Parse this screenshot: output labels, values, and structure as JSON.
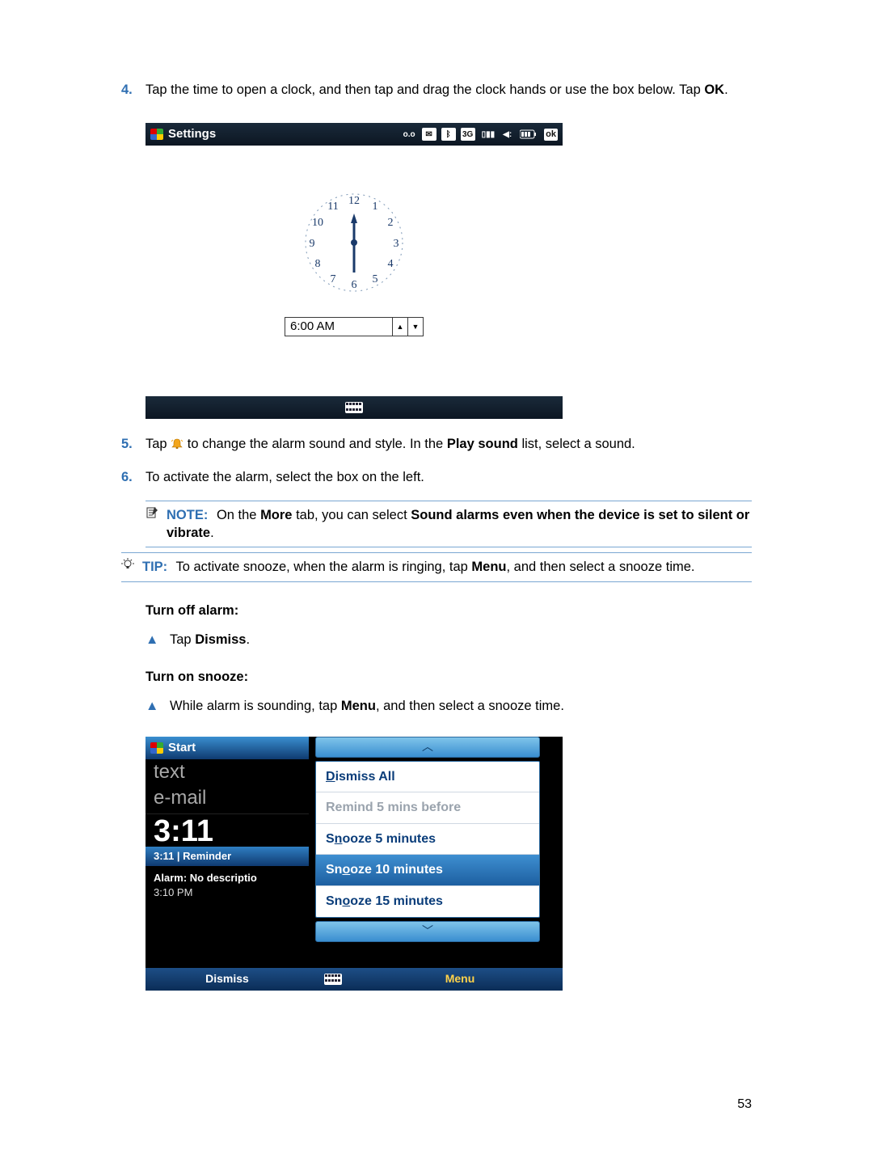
{
  "page_number": "53",
  "steps": {
    "s4": {
      "num": "4.",
      "text_a": "Tap the time to open a clock, and then tap and drag the clock hands or use the box below. Tap ",
      "ok": "OK",
      "text_b": "."
    },
    "s5": {
      "num": "5.",
      "text_a": "Tap ",
      "text_b": " to change the alarm sound and style. In the ",
      "play_sound": "Play sound",
      "text_c": " list, select a sound."
    },
    "s6": {
      "num": "6.",
      "text": "To activate the alarm, select the box on the left."
    }
  },
  "note": {
    "label": "NOTE:",
    "a": "On the ",
    "more": "More",
    "b": " tab, you can select ",
    "bold1": "Sound alarms even when the device is set to silent or vibrate",
    "c": "."
  },
  "tip": {
    "label": "TIP:",
    "a": "To activate snooze, when the alarm is ringing, tap ",
    "menu": "Menu",
    "b": ", and then select a snooze time."
  },
  "turn_off": {
    "head": "Turn off alarm",
    "a": "Tap ",
    "dismiss": "Dismiss",
    "b": "."
  },
  "turn_on": {
    "head": "Turn on snooze",
    "a": "While alarm is sounding, tap ",
    "menu": "Menu",
    "b": ", and then select a snooze time."
  },
  "shot1": {
    "title": "Settings",
    "icons": {
      "voicemail": "ᴏ.ᴏ",
      "mail": "✉",
      "bt": "ᛒ",
      "threeg": "3G",
      "signal": "📶",
      "sound": "◀:",
      "battery": "▮▮▮▯",
      "ok": "ok"
    },
    "time": "6:00 AM",
    "clock_numbers": [
      "12",
      "1",
      "2",
      "3",
      "4",
      "5",
      "6",
      "7",
      "8",
      "9",
      "10",
      "11"
    ]
  },
  "shot2": {
    "start": "Start",
    "text_row": "text",
    "email_row": "e-mail",
    "big_time": "3:11",
    "reminder_bar": "3:11 | Reminder",
    "alarm_title": "Alarm: No descriptio",
    "alarm_time": "3:10 PM",
    "menu": {
      "dismiss_all": "Dismiss All",
      "remind5": "Remind 5 mins before",
      "sn5": "Snooze 5 minutes",
      "sn10": "Snooze 10 minutes",
      "sn15": "Snooze 15 minutes"
    },
    "softkeys": {
      "left": "Dismiss",
      "right": "Menu"
    }
  }
}
